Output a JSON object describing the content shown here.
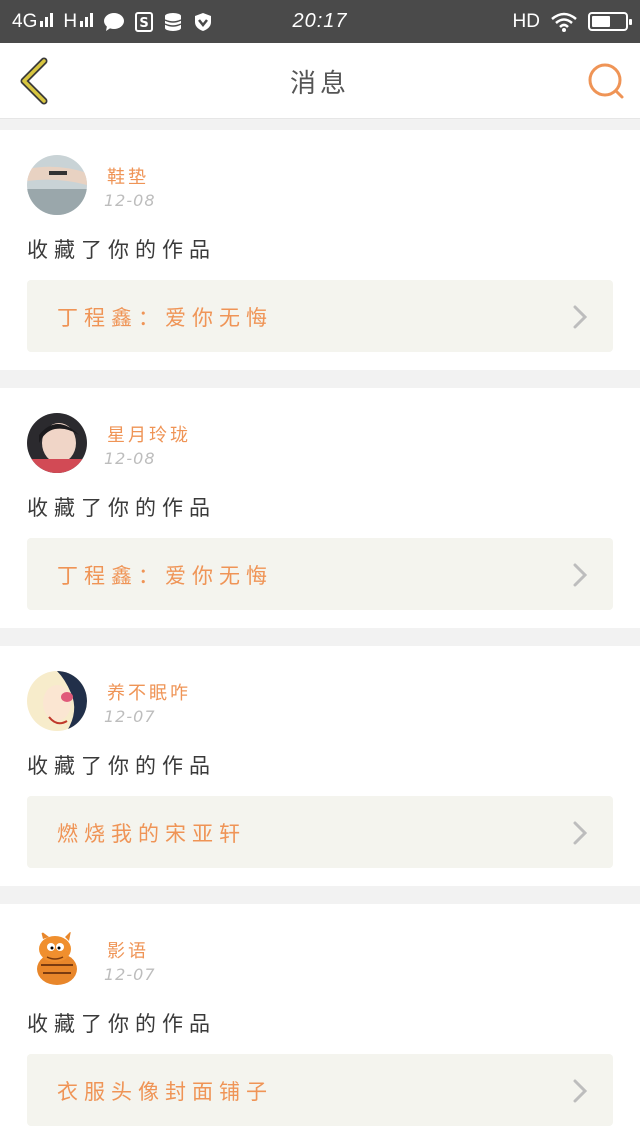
{
  "status_bar": {
    "network_left": "4G",
    "network_right": "H",
    "time": "20:17",
    "hd_label": "HD",
    "battery_level": 0.55
  },
  "header": {
    "title": "消息",
    "back_icon": "chevron-left-icon",
    "search_icon": "search-icon"
  },
  "colors": {
    "accent": "#ef9456",
    "back_arrow": "#d8c640",
    "card_link_bg": "#f4f4ee"
  },
  "messages": [
    {
      "user": "鞋垫",
      "date": "12-08",
      "action": "收藏了你的作品",
      "work": "丁程鑫：爱你无悔"
    },
    {
      "user": "星月玲珑",
      "date": "12-08",
      "action": "收藏了你的作品",
      "work": "丁程鑫：爱你无悔"
    },
    {
      "user": "养不眠咋",
      "date": "12-07",
      "action": "收藏了你的作品",
      "work": "燃烧我的宋亚轩"
    },
    {
      "user": "影语",
      "date": "12-07",
      "action": "收藏了你的作品",
      "work": "衣服头像封面铺子"
    }
  ]
}
